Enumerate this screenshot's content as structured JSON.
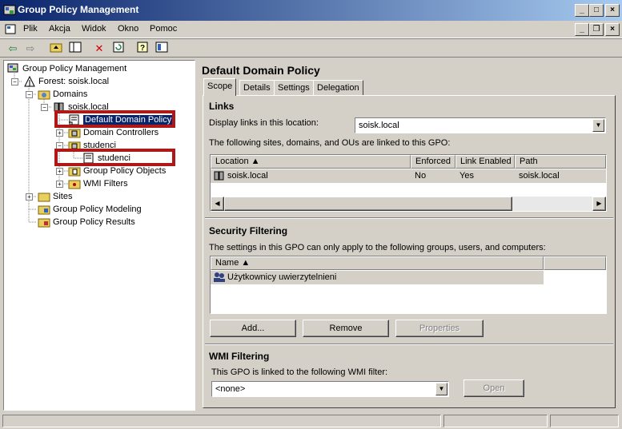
{
  "window": {
    "title": "Group Policy Management"
  },
  "menu": [
    {
      "label": "Plik"
    },
    {
      "label": "Akcja"
    },
    {
      "label": "Widok"
    },
    {
      "label": "Okno"
    },
    {
      "label": "Pomoc"
    }
  ],
  "tree": {
    "root": "Group Policy Management",
    "forest": "Forest: soisk.local",
    "domains": "Domains",
    "domain": "soisk.local",
    "default_policy": "Default Domain Policy",
    "domain_controllers": "Domain Controllers",
    "studenci_ou": "studenci",
    "studenci_gpo": "studenci",
    "gpo_objects": "Group Policy Objects",
    "wmi_filters": "WMI Filters",
    "sites": "Sites",
    "modeling": "Group Policy Modeling",
    "results": "Group Policy Results"
  },
  "details": {
    "title": "Default Domain Policy",
    "tabs": [
      "Scope",
      "Details",
      "Settings",
      "Delegation"
    ],
    "links": {
      "heading": "Links",
      "display_label": "Display links in this location:",
      "location_value": "soisk.local",
      "description": "The following sites, domains, and OUs are linked to this GPO:",
      "columns": [
        "Location",
        "Enforced",
        "Link Enabled",
        "Path"
      ],
      "rows": [
        {
          "location": "soisk.local",
          "enforced": "No",
          "link_enabled": "Yes",
          "path": "soisk.local"
        }
      ]
    },
    "security": {
      "heading": "Security Filtering",
      "description": "The settings in this GPO can only apply to the following groups, users, and computers:",
      "columns": [
        "Name"
      ],
      "rows": [
        {
          "name": "Użytkownicy uwierzytelnieni"
        }
      ],
      "add": "Add...",
      "remove": "Remove",
      "properties": "Properties"
    },
    "wmi": {
      "heading": "WMI Filtering",
      "description": "This GPO is linked to the following WMI filter:",
      "value": "<none>",
      "open": "Open"
    }
  }
}
